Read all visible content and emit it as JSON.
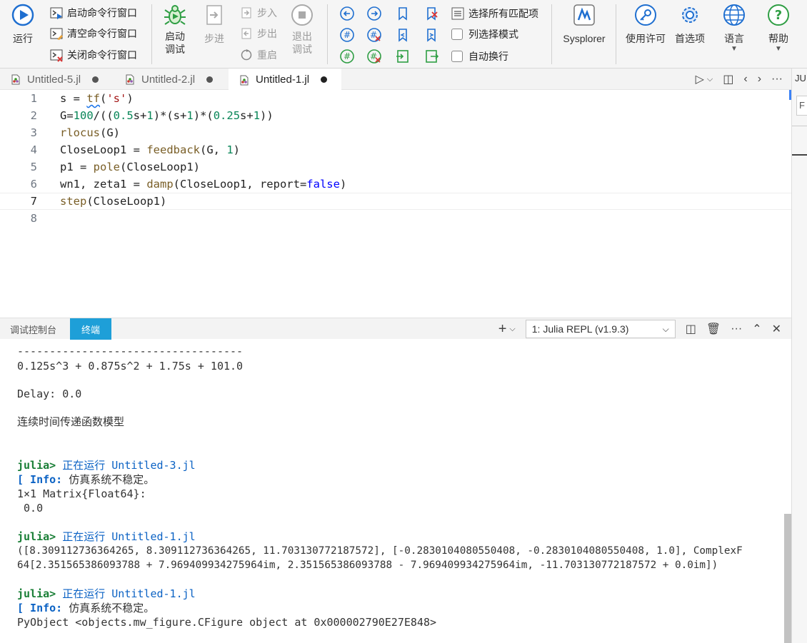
{
  "toolbar": {
    "run": "运行",
    "start_cmd_window": "启动命令行窗口",
    "clear_cmd_window": "清空命令行窗口",
    "close_cmd_window": "关闭命令行窗口",
    "start_debug_l1": "启动",
    "start_debug_l2": "调试",
    "step": "步进",
    "step_in": "步入",
    "step_out": "步出",
    "restart": "重启",
    "exit_debug_l1": "退出",
    "exit_debug_l2": "调试",
    "select_all_matches": "选择所有匹配项",
    "column_select": "列选择模式",
    "auto_wrap": "自动换行",
    "sysplorer": "Sysplorer",
    "license": "使用许可",
    "preferences": "首选项",
    "language": "语言",
    "help": "帮助"
  },
  "tabs": [
    {
      "label": "Untitled-5.jl"
    },
    {
      "label": "Untitled-2.jl"
    },
    {
      "label": "Untitled-1.jl"
    }
  ],
  "right_strip": {
    "top": "JU",
    "field": "F"
  },
  "editor": {
    "line_numbers": [
      "1",
      "2",
      "3",
      "4",
      "5",
      "6",
      "7",
      "8"
    ],
    "lines": [
      "s = tf('s')",
      "G=100/((0.5s+1)*(s+1)*(0.25s+1))",
      "rlocus(G)",
      "CloseLoop1 = feedback(G, 1)",
      "p1 = pole(CloseLoop1)",
      "wn1, zeta1 = damp(CloseLoop1, report=false)",
      "step(CloseLoop1)",
      ""
    ]
  },
  "panel": {
    "tab_debug": "调试控制台",
    "tab_terminal": "终端",
    "repl_selected": "1: Julia REPL (v1.9.3)"
  },
  "terminal": {
    "dashes": "-----------------------------------",
    "denominator": "0.125s^3 + 0.875s^2 + 1.75s + 101.0",
    "delay": "Delay: 0.0",
    "model": "连续时间传递函数模型",
    "prompt": "julia>",
    "running_label": "正在运行",
    "file3": "Untitled-3.jl",
    "file1": "Untitled-1.jl",
    "info_tag": "[ Info:",
    "unstable": "仿真系统不稳定。",
    "matrix": "1×1 Matrix{Float64}:",
    "matrix_val": " 0.0",
    "result_l1": "([8.309112736364265, 8.309112736364265, 11.703130772187572], [-0.2830104080550408, -0.2830104080550408, 1.0], ComplexF",
    "result_l2": "64[2.351565386093788 + 7.969409934275964im, 2.351565386093788 - 7.969409934275964im, -11.703130772187572 + 0.0im])",
    "pyobject": "PyObject <objects.mw_figure.CFigure object at 0x000002790E27E848>"
  }
}
